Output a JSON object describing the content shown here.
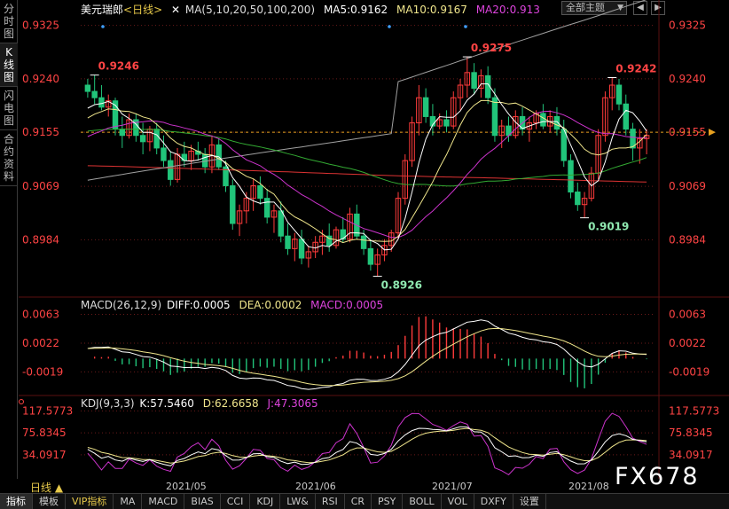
{
  "left_tabs": [
    {
      "label": "分时图",
      "active": false
    },
    {
      "label": "K线图",
      "active": true
    },
    {
      "label": "闪电图",
      "active": false
    },
    {
      "label": "合约资料",
      "active": false
    }
  ],
  "main_legend": {
    "symbol": "美元瑞郎",
    "period": "<日线>",
    "ma_label": "MA(5,10,20,50,100,200)",
    "ma5": "MA5:0.9162",
    "ma10": "MA10:0.9167",
    "ma20": "MA20:0.913"
  },
  "theme_select": {
    "value": "全部主题"
  },
  "window_buttons": [
    "◀",
    "▶"
  ],
  "price_axis": [
    "0.9325",
    "0.9240",
    "0.9155",
    "0.9069",
    "0.8984"
  ],
  "current_price_marker": "0.9155",
  "annotations": {
    "high1": "0.9246",
    "low1": "0.8926",
    "high2": "0.9275",
    "low2": "0.9019",
    "high3": "0.9242"
  },
  "macd_legend": {
    "label": "MACD(26,12,9)",
    "diff": "DIFF:0.0005",
    "dea": "DEA:0.0002",
    "macd": "MACD:0.0005"
  },
  "macd_axis": [
    "0.0063",
    "0.0022",
    "-0.0019"
  ],
  "kdj_legend": {
    "label": "KDJ(9,3,3)",
    "k": "K:57.5460",
    "d": "D:62.6658",
    "j": "J:47.3065"
  },
  "kdj_axis": [
    "117.5773",
    "75.8345",
    "34.0917"
  ],
  "date_axis": [
    "2021/05",
    "2021/06",
    "2021/07",
    "2021/08"
  ],
  "period_label": "日线 ▲",
  "watermark": "FX678",
  "bottom_tabs": [
    {
      "label": "指标",
      "active": true
    },
    {
      "label": "模板"
    },
    {
      "label": "VIP指标",
      "vip": true
    },
    {
      "label": "MA"
    },
    {
      "label": "MACD"
    },
    {
      "label": "BIAS"
    },
    {
      "label": "CCI"
    },
    {
      "label": "KDJ"
    },
    {
      "label": "LW&"
    },
    {
      "label": "RSI"
    },
    {
      "label": "CR"
    },
    {
      "label": "PSY"
    },
    {
      "label": "BOLL"
    },
    {
      "label": "VOL"
    },
    {
      "label": "DXFY"
    },
    {
      "label": "设置"
    }
  ],
  "colors": {
    "up": "#ff3b3b",
    "down": "#21c47a",
    "ma5": "#ffffff",
    "ma10": "#f0e68c",
    "ma20": "#cc33cc",
    "ma50": "#33aa33",
    "ma100": "#a0a0a0",
    "ma200": "#dd3333",
    "axis_text": "#ff4444",
    "grid": "#6a1a1a"
  },
  "chart_data": {
    "type": "candlestick",
    "price_range": [
      0.89,
      0.934
    ],
    "ohlc": [
      [
        0.923,
        0.924,
        0.921,
        0.922
      ],
      [
        0.922,
        0.9246,
        0.92,
        0.921
      ],
      [
        0.921,
        0.923,
        0.919,
        0.9195
      ],
      [
        0.9195,
        0.9215,
        0.918,
        0.9205
      ],
      [
        0.9205,
        0.921,
        0.915,
        0.916
      ],
      [
        0.916,
        0.918,
        0.913,
        0.915
      ],
      [
        0.915,
        0.9185,
        0.9145,
        0.9175
      ],
      [
        0.9175,
        0.9185,
        0.914,
        0.915
      ],
      [
        0.915,
        0.917,
        0.912,
        0.914
      ],
      [
        0.914,
        0.9165,
        0.9125,
        0.916
      ],
      [
        0.916,
        0.917,
        0.912,
        0.913
      ],
      [
        0.913,
        0.915,
        0.91,
        0.911
      ],
      [
        0.911,
        0.9125,
        0.907,
        0.908
      ],
      [
        0.908,
        0.913,
        0.9075,
        0.912
      ],
      [
        0.912,
        0.914,
        0.91,
        0.911
      ],
      [
        0.911,
        0.9135,
        0.9095,
        0.9125
      ],
      [
        0.9125,
        0.914,
        0.911,
        0.912
      ],
      [
        0.912,
        0.913,
        0.909,
        0.91
      ],
      [
        0.91,
        0.915,
        0.909,
        0.9135
      ],
      [
        0.9135,
        0.9145,
        0.9095,
        0.91
      ],
      [
        0.91,
        0.911,
        0.906,
        0.907
      ],
      [
        0.907,
        0.908,
        0.9,
        0.901
      ],
      [
        0.901,
        0.904,
        0.899,
        0.903
      ],
      [
        0.903,
        0.906,
        0.901,
        0.905
      ],
      [
        0.905,
        0.908,
        0.903,
        0.907
      ],
      [
        0.907,
        0.9085,
        0.904,
        0.905
      ],
      [
        0.905,
        0.9065,
        0.901,
        0.902
      ],
      [
        0.902,
        0.904,
        0.8995,
        0.903
      ],
      [
        0.903,
        0.9045,
        0.898,
        0.899
      ],
      [
        0.899,
        0.901,
        0.896,
        0.897
      ],
      [
        0.897,
        0.8995,
        0.895,
        0.8985
      ],
      [
        0.8985,
        0.9,
        0.8945,
        0.8955
      ],
      [
        0.8955,
        0.8975,
        0.894,
        0.8965
      ],
      [
        0.8965,
        0.899,
        0.8955,
        0.898
      ],
      [
        0.898,
        0.9,
        0.896,
        0.899
      ],
      [
        0.899,
        0.901,
        0.8965,
        0.8975
      ],
      [
        0.8975,
        0.9005,
        0.897,
        0.9
      ],
      [
        0.9,
        0.902,
        0.898,
        0.8985
      ],
      [
        0.8985,
        0.9035,
        0.898,
        0.9025
      ],
      [
        0.9025,
        0.904,
        0.8985,
        0.899
      ],
      [
        0.899,
        0.9,
        0.896,
        0.897
      ],
      [
        0.897,
        0.8985,
        0.8935,
        0.8945
      ],
      [
        0.8945,
        0.897,
        0.8926,
        0.896
      ],
      [
        0.896,
        0.8985,
        0.895,
        0.8975
      ],
      [
        0.8975,
        0.9,
        0.8965,
        0.8995
      ],
      [
        0.8995,
        0.906,
        0.8985,
        0.905
      ],
      [
        0.905,
        0.912,
        0.904,
        0.911
      ],
      [
        0.911,
        0.918,
        0.91,
        0.917
      ],
      [
        0.917,
        0.923,
        0.915,
        0.921
      ],
      [
        0.921,
        0.9225,
        0.917,
        0.918
      ],
      [
        0.918,
        0.92,
        0.915,
        0.9165
      ],
      [
        0.9165,
        0.9185,
        0.916,
        0.9175
      ],
      [
        0.9175,
        0.919,
        0.9155,
        0.9165
      ],
      [
        0.9165,
        0.922,
        0.916,
        0.921
      ],
      [
        0.921,
        0.924,
        0.919,
        0.923
      ],
      [
        0.923,
        0.9275,
        0.921,
        0.925
      ],
      [
        0.925,
        0.9265,
        0.9215,
        0.9225
      ],
      [
        0.9225,
        0.9255,
        0.921,
        0.9245
      ],
      [
        0.9245,
        0.926,
        0.92,
        0.921
      ],
      [
        0.921,
        0.9225,
        0.914,
        0.915
      ],
      [
        0.915,
        0.9175,
        0.913,
        0.9165
      ],
      [
        0.9165,
        0.918,
        0.914,
        0.915
      ],
      [
        0.915,
        0.919,
        0.9145,
        0.918
      ],
      [
        0.918,
        0.9195,
        0.915,
        0.916
      ],
      [
        0.916,
        0.918,
        0.914,
        0.917
      ],
      [
        0.917,
        0.919,
        0.916,
        0.9185
      ],
      [
        0.9185,
        0.92,
        0.916,
        0.9165
      ],
      [
        0.9165,
        0.919,
        0.9155,
        0.918
      ],
      [
        0.918,
        0.9195,
        0.915,
        0.916
      ],
      [
        0.916,
        0.9175,
        0.91,
        0.911
      ],
      [
        0.911,
        0.912,
        0.905,
        0.906
      ],
      [
        0.906,
        0.9075,
        0.903,
        0.904
      ],
      [
        0.904,
        0.906,
        0.9019,
        0.905
      ],
      [
        0.905,
        0.91,
        0.9045,
        0.909
      ],
      [
        0.909,
        0.916,
        0.908,
        0.915
      ],
      [
        0.915,
        0.922,
        0.914,
        0.921
      ],
      [
        0.921,
        0.9242,
        0.919,
        0.923
      ],
      [
        0.923,
        0.924,
        0.919,
        0.92
      ],
      [
        0.92,
        0.9215,
        0.915,
        0.916
      ],
      [
        0.916,
        0.917,
        0.911,
        0.913
      ],
      [
        0.913,
        0.916,
        0.9105,
        0.9145
      ],
      [
        0.9145,
        0.916,
        0.912,
        0.915
      ]
    ]
  }
}
